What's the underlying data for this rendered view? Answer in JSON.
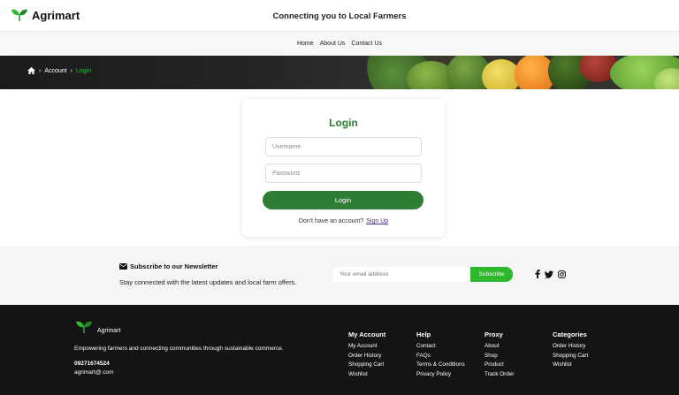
{
  "header": {
    "brand": "Agrimart",
    "tagline": "Connecting you to Local Farmers"
  },
  "nav": {
    "items": [
      {
        "label": "Home"
      },
      {
        "label": "About Us"
      },
      {
        "label": "Contact Us"
      }
    ]
  },
  "breadcrumb": {
    "icon": "home-icon",
    "items": [
      "Account",
      "Login"
    ],
    "separator": "›"
  },
  "login": {
    "title": "Login",
    "username_placeholder": "Username",
    "password_placeholder": "Password",
    "button": "Login",
    "prompt": "Don't have an account?",
    "signup": "Sign Up"
  },
  "newsletter": {
    "title": "Subscribe to our Newsletter",
    "subtitle": "Stay connected with the latest updates and local farm offers.",
    "email_placeholder": "Your email address",
    "button": "Subscribe",
    "social": [
      "facebook-icon",
      "twitter-icon",
      "instagram-icon"
    ]
  },
  "footer": {
    "brand": "Agrimart",
    "description": "Empowering farmers and connecting communities through sustainable commerce.",
    "phone": "09271674524",
    "email": "agrimart@.com",
    "columns": [
      {
        "title": "My Account",
        "links": [
          "My Account",
          "Order History",
          "Shopping Cart",
          "Wishlist"
        ]
      },
      {
        "title": "Help",
        "links": [
          "Contact",
          "FAQs",
          "Terms & Conditions",
          "Privacy Policy"
        ]
      },
      {
        "title": "Proxy",
        "links": [
          "About",
          "Shop",
          "Product",
          "Track Order"
        ]
      },
      {
        "title": "Categories",
        "links": [
          "Order History",
          "Shopping Cart",
          "Wishlist"
        ]
      }
    ]
  },
  "colors": {
    "primary_green": "#2e7d32",
    "accent_green": "#2eb82e",
    "breadcrumb_active": "#33b34a",
    "footer_bg": "#141414"
  }
}
